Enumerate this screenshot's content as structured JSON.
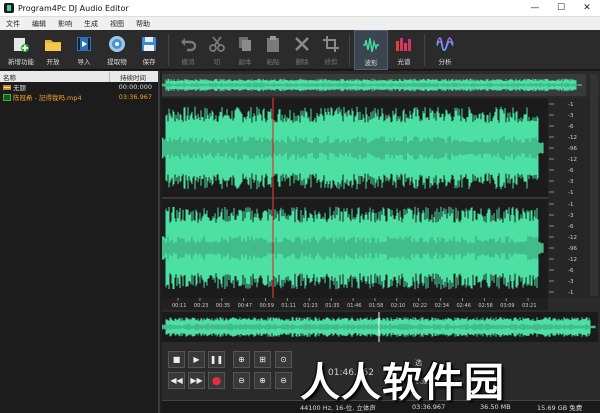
{
  "window": {
    "title": "Program4Pc DJ Audio Editor",
    "minimize": "—",
    "maximize": "☐",
    "close": "✕"
  },
  "menu": [
    "文件",
    "编辑",
    "影响",
    "生成",
    "视图",
    "帮助"
  ],
  "toolbar": [
    {
      "label": "新增功能",
      "icon": "new-feature-icon",
      "state": "normal"
    },
    {
      "label": "开放",
      "icon": "open-folder-icon",
      "state": "normal"
    },
    {
      "label": "导入",
      "icon": "import-video-icon",
      "state": "normal"
    },
    {
      "label": "提取物",
      "icon": "extract-disc-icon",
      "state": "normal"
    },
    {
      "label": "保存",
      "icon": "save-icon",
      "state": "normal"
    },
    {
      "label": "撤消",
      "icon": "undo-icon",
      "state": "disabled"
    },
    {
      "label": "切",
      "icon": "cut-icon",
      "state": "disabled"
    },
    {
      "label": "副本",
      "icon": "copy-icon",
      "state": "disabled"
    },
    {
      "label": "粘贴",
      "icon": "paste-icon",
      "state": "disabled"
    },
    {
      "label": "删除",
      "icon": "delete-icon",
      "state": "disabled"
    },
    {
      "label": "修剪",
      "icon": "trim-icon",
      "state": "disabled"
    },
    {
      "label": "波形",
      "icon": "waveform-icon",
      "state": "active"
    },
    {
      "label": "光谱",
      "icon": "spectrum-icon",
      "state": "normal"
    },
    {
      "label": "分析",
      "icon": "analysis-icon",
      "state": "normal"
    }
  ],
  "file_list": {
    "headers": {
      "name": "名称",
      "duration": "持续时间"
    },
    "rows": [
      {
        "name": "无题",
        "duration": "00:00:000",
        "selected": false
      },
      {
        "name": "陈冠希 - 記得我吗.mp4",
        "duration": "03:36.967",
        "selected": true
      }
    ]
  },
  "timeline_ticks": [
    "00:11",
    "00:23",
    "00:35",
    "00:47",
    "00:59",
    "01:11",
    "01:23",
    "01:35",
    "01:46",
    "01:58",
    "02:10",
    "02:22",
    "02:34",
    "02:46",
    "02:58",
    "03:09",
    "03:21"
  ],
  "db_scale_top": [
    "-1",
    "-3",
    "-6",
    "-12",
    "-96",
    "-12",
    "-6",
    "-3",
    "-1"
  ],
  "db_scale_bottom": [
    "-1",
    "-3",
    "-6",
    "-12",
    "-96",
    "-12",
    "-6",
    "-3",
    "-1"
  ],
  "info": {
    "position": "01:46.752",
    "selection_label": "选",
    "length_label": "长度",
    "total": "03:36.967",
    "file_size": "36.50 MB",
    "format": "44100 Hz, 16-位, 立体声",
    "free_space": "15.69 GB 免费"
  },
  "watermark": "人人软件园",
  "colors": {
    "waveform": "#4ce0a4",
    "waveform_dark": "#2a9f72",
    "playhead": "#d63a2c",
    "accent_orange": "#f2a52a"
  }
}
